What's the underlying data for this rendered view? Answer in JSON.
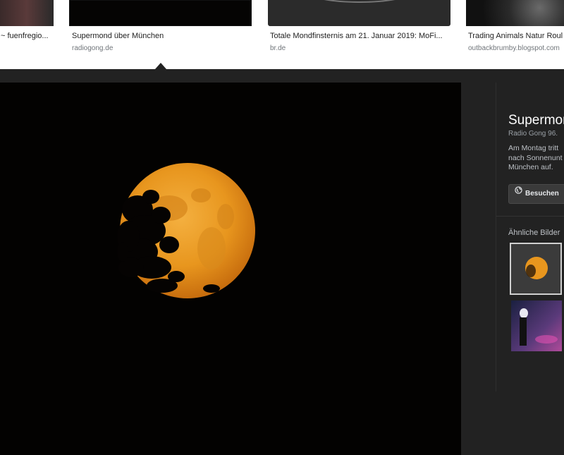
{
  "results": [
    {
      "title": "~ fuenfregio...",
      "source": ""
    },
    {
      "title": "Supermond über München",
      "source": "radiogong.de"
    },
    {
      "title": "Totale Mondfinsternis am 21. Januar 2019: MoFi...",
      "source": "br.de"
    },
    {
      "title": "Trading Animals Natur Roul",
      "source": "outbackbrumby.blogspot.com"
    }
  ],
  "panel": {
    "title": "Supermond",
    "source": "Radio Gong 96.",
    "description_lines": [
      "Am Montag tritt",
      "nach Sonnenunt",
      "München auf."
    ],
    "visit_label": "Besuchen",
    "similar_label": "Ähnliche Bilder"
  },
  "icons": {
    "visit": "globe-icon"
  },
  "colors": {
    "viewer_bg": "#222222",
    "moon": "#e8961e",
    "selected_border": "#d0d0d0"
  }
}
